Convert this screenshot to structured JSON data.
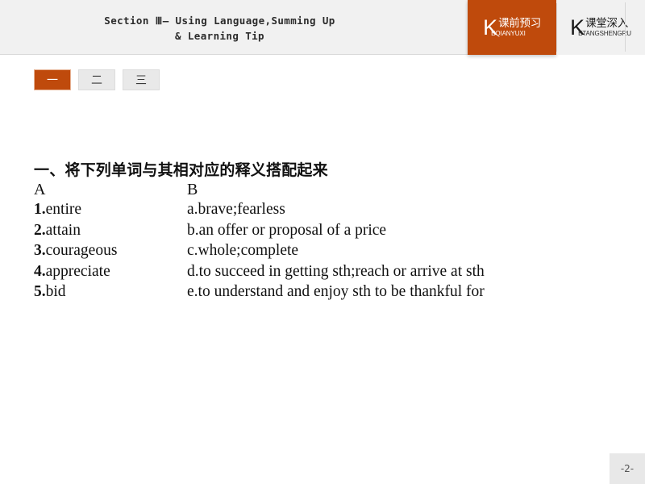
{
  "header": {
    "title": "Section Ⅲ— Using Language,Summing Up\n& Learning Tip",
    "section_tabs": [
      {
        "letter": "K",
        "cn": "课前预习",
        "pinyin": "EQIANYUXI",
        "active": true
      },
      {
        "letter": "K",
        "cn": "课堂深入",
        "pinyin": "ETANGSHENGRU",
        "active": false
      }
    ]
  },
  "number_tabs": [
    {
      "label": "一",
      "active": true
    },
    {
      "label": "二",
      "active": false
    },
    {
      "label": "三",
      "active": false
    }
  ],
  "main": {
    "question_heading": "一、将下列单词与其相对应的释义搭配起来",
    "column_a_label": "A",
    "column_b_label": "B",
    "rows": [
      {
        "index": "1.",
        "word": "entire",
        "option": "a.",
        "definition": "brave;fearless"
      },
      {
        "index": "2.",
        "word": "attain",
        "option": "b.",
        "definition": "an offer or proposal of a price"
      },
      {
        "index": "3.",
        "word": "courageous",
        "option": "c.",
        "definition": "whole;complete"
      },
      {
        "index": "4.",
        "word": "appreciate",
        "option": "d.",
        "definition": "to succeed in getting sth;reach or arrive at sth"
      },
      {
        "index": "5.",
        "word": "bid",
        "option": "e.",
        "definition": "to understand and enjoy sth to be thankful for"
      }
    ]
  },
  "footer": {
    "page_number": "-2-"
  },
  "colors": {
    "accent_orange": "#bf4a0c",
    "header_bg": "#f1f1f1",
    "tab_inactive_bg": "#e9e9e9",
    "page_badge_bg": "#e8e8e8"
  }
}
